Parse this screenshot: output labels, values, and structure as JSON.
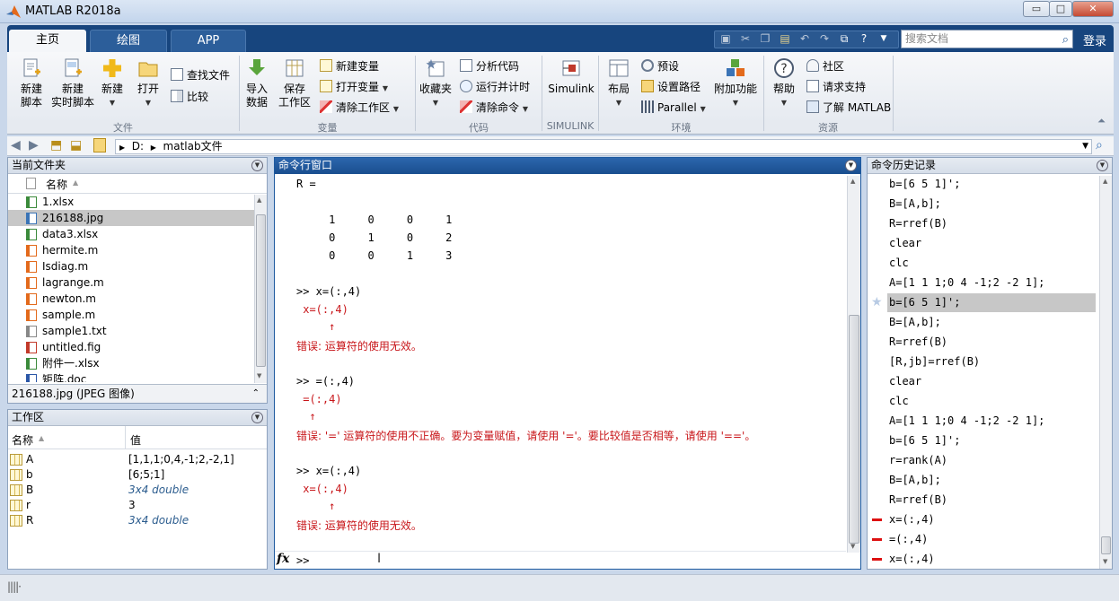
{
  "window": {
    "title": "MATLAB R2018a",
    "buttons": {
      "minimize": "▭",
      "maximize": "□",
      "close": "✕"
    }
  },
  "tabs": [
    {
      "label": "主页"
    },
    {
      "label": "绘图"
    },
    {
      "label": "APP"
    }
  ],
  "search": {
    "placeholder": "搜索文档"
  },
  "login": "登录",
  "ribbon": {
    "file": {
      "group": "文件",
      "new_script": "新建\n脚本",
      "new_live": "新建\n实时脚本",
      "new": "新建",
      "open": "打开",
      "find_files": "查找文件",
      "compare": "比较"
    },
    "variable": {
      "group": "变量",
      "import": "导入\n数据",
      "save": "保存\n工作区",
      "new_var": "新建变量",
      "open_var": "打开变量",
      "clear_ws": "清除工作区"
    },
    "code": {
      "group": "代码",
      "favorites": "收藏夹",
      "analyze": "分析代码",
      "run_time": "运行并计时",
      "clear_cmds": "清除命令"
    },
    "simulink": {
      "group": "SIMULINK",
      "label": "Simulink"
    },
    "env": {
      "group": "环境",
      "layout": "布局",
      "prefs": "预设",
      "set_path": "设置路径",
      "parallel": "Parallel",
      "addons": "附加功能"
    },
    "resources": {
      "group": "资源",
      "help": "帮助",
      "community": "社区",
      "support": "请求支持",
      "learn": "了解 MATLAB"
    }
  },
  "address": {
    "drive": "D:",
    "folder": "matlab文件"
  },
  "current_folder": {
    "title": "当前文件夹",
    "column": "名称",
    "files": [
      {
        "name": "1.xlsx",
        "type": "xlsx"
      },
      {
        "name": "216188.jpg",
        "type": "jpg",
        "selected": true
      },
      {
        "name": "data3.xlsx",
        "type": "xlsx"
      },
      {
        "name": "hermite.m",
        "type": "m"
      },
      {
        "name": "Isdiag.m",
        "type": "m"
      },
      {
        "name": "lagrange.m",
        "type": "m"
      },
      {
        "name": "newton.m",
        "type": "m"
      },
      {
        "name": "sample.m",
        "type": "m"
      },
      {
        "name": "sample1.txt",
        "type": "txt"
      },
      {
        "name": "untitled.fig",
        "type": "fig"
      },
      {
        "name": "附件一.xlsx",
        "type": "xlsx"
      },
      {
        "name": "矩阵.doc",
        "type": "doc"
      }
    ],
    "details": "216188.jpg  (JPEG 图像)"
  },
  "workspace": {
    "title": "工作区",
    "col_name": "名称",
    "col_value": "值",
    "vars": [
      {
        "name": "A",
        "value": "[1,1,1;0,4,-1;2,-2,1]",
        "italic": false
      },
      {
        "name": "b",
        "value": "[6;5;1]",
        "italic": false
      },
      {
        "name": "B",
        "value": "3x4 double",
        "italic": true
      },
      {
        "name": "r",
        "value": "3",
        "italic": false
      },
      {
        "name": "R",
        "value": "3x4 double",
        "italic": true
      }
    ]
  },
  "command_window": {
    "title": "命令行窗口",
    "lines": [
      {
        "text": "R =",
        "cls": ""
      },
      {
        "text": "     1     0     0     1",
        "cls": ""
      },
      {
        "text": "     0     1     0     2",
        "cls": ""
      },
      {
        "text": "     0     0     1     3",
        "cls": ""
      },
      {
        "text": ">> x=(:,4)",
        "cls": ""
      },
      {
        "text": " x=(:,4)",
        "cls": "red"
      },
      {
        "text": "     ↑",
        "cls": "red"
      },
      {
        "text": "错误: 运算符的使用无效。",
        "cls": "red"
      },
      {
        "text": ">> =(:,4)",
        "cls": ""
      },
      {
        "text": " =(:,4)",
        "cls": "red"
      },
      {
        "text": "  ↑",
        "cls": "red"
      },
      {
        "text": "错误: '=' 运算符的使用不正确。要为变量赋值，请使用 '='。要比较值是否相等，请使用 '=='。",
        "cls": "red"
      },
      {
        "text": ">> x=(:,4)",
        "cls": ""
      },
      {
        "text": " x=(:,4)",
        "cls": "red"
      },
      {
        "text": "     ↑",
        "cls": "red"
      },
      {
        "text": "错误: 运算符的使用无效。",
        "cls": "red"
      }
    ],
    "prompt": ">>",
    "fx": "fx"
  },
  "history": {
    "title": "命令历史记录",
    "items": [
      {
        "text": "b=[6 5 1]';",
        "mark": ""
      },
      {
        "text": "B=[A,b];",
        "mark": ""
      },
      {
        "text": "R=rref(B)",
        "mark": ""
      },
      {
        "text": "clear",
        "mark": ""
      },
      {
        "text": "clc",
        "mark": ""
      },
      {
        "text": "A=[1 1 1;0 4 -1;2 -2 1];",
        "mark": ""
      },
      {
        "text": "b=[6 5 1]';",
        "mark": "star",
        "selected": true
      },
      {
        "text": "B=[A,b];",
        "mark": ""
      },
      {
        "text": "R=rref(B)",
        "mark": ""
      },
      {
        "text": "[R,jb]=rref(B)",
        "mark": ""
      },
      {
        "text": "clear",
        "mark": ""
      },
      {
        "text": "clc",
        "mark": ""
      },
      {
        "text": "A=[1 1 1;0 4 -1;2 -2 1];",
        "mark": ""
      },
      {
        "text": "b=[6 5 1]';",
        "mark": ""
      },
      {
        "text": "r=rank(A)",
        "mark": ""
      },
      {
        "text": "B=[A,b];",
        "mark": ""
      },
      {
        "text": "R=rref(B)",
        "mark": ""
      },
      {
        "text": "x=(:,4)",
        "mark": "error"
      },
      {
        "text": "=(:,4)",
        "mark": "error"
      },
      {
        "text": "x=(:,4)",
        "mark": "error"
      }
    ]
  },
  "colors": {
    "accent": "#17457e",
    "error": "#c8161a",
    "selection": "#c7c7c7",
    "italic_value": "#2b5c8e"
  }
}
